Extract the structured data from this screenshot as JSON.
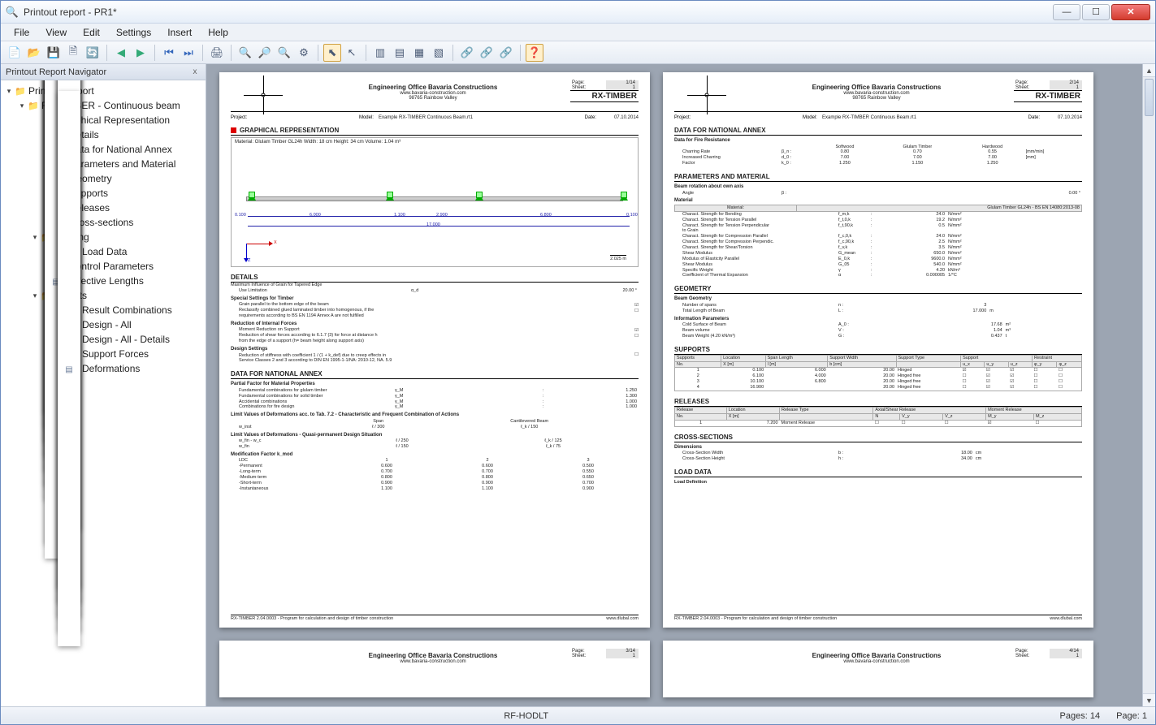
{
  "window": {
    "title": "Printout report - PR1*"
  },
  "menu": {
    "file": "File",
    "view": "View",
    "edit": "Edit",
    "settings": "Settings",
    "insert": "Insert",
    "help": "Help"
  },
  "navigator": {
    "title": "Printout Report Navigator",
    "close": "x"
  },
  "tree": {
    "root": "Printout Report",
    "n1": "RX-TIMBER - Continuous beam",
    "graphical": "Graphical Representation",
    "details": "Details",
    "annex": "Data for National Annex",
    "param": "Parameters and Material",
    "geom": "Geometry",
    "supports": "Supports",
    "releases": "Releases",
    "cross": "Cross-sections",
    "loading": "Loading",
    "loaddata": "Load Data",
    "control": "Control Parameters",
    "efflen": "Effective Lengths",
    "results": "Results",
    "rescomb": "Result Combinations",
    "designall": "Design - All",
    "designdet": "Design - All - Details",
    "suppforce": "Support Forces",
    "deform": "Deformations"
  },
  "company": {
    "name": "Engineering Office Bavaria Constructions",
    "web": "www.bavaria-construction.com",
    "addr": "98765 Rainbow Valley",
    "brand": "RX-TIMBER"
  },
  "projrow": {
    "projlbl": "Project:",
    "modellbl": "Model:",
    "model": "Example RX-TIMBER Continuous Beam.rt1",
    "datelbl": "Date:",
    "date": "07.10.2014"
  },
  "page1": {
    "pageLbl": "Page:",
    "pageVal": "1/14",
    "sheetLbl": "Sheet:",
    "sheetVal": "1",
    "s1": "GRAPHICAL REPRESENTATION",
    "beaminfo": "Material: Glulam Timber GL24h   Width: 18 cm   Height: 34 cm   Volume: 1.04 m³",
    "dim": {
      "a": "0.100",
      "b": "6.000",
      "c": "1.100",
      "d": "2.900",
      "e": "6.800",
      "f": "0.100",
      "total": "17.000"
    },
    "scale": "2.025 m",
    "details_title": "DETAILS",
    "details": {
      "l1": "Maximum Influence of Grain for Tapered Edge",
      "l1b": "Use Limitation",
      "alpha": "α_d",
      "deg20": "20.00  °",
      "l2": "Special Settings for Timber",
      "l2a": "Grain parallel to the bottom edge of the beam",
      "l2b": "Reclassify combined glued laminated timber into homogenous, if the",
      "l2c": "requirements according to BS EN 1194 Annex A are not fulfilled",
      "l3": "Reduction of Internal Forces",
      "l3a": "Moment Reduction on Support",
      "l3b": "Reduction of shear forces according to 6.1.7 (3) for force at distance h",
      "l3b2": "from the edge of a support (h= beam height along support axis)",
      "l4": "Design Settings",
      "l4a": "Reduction of stiffness with coefficient 1 / (1 + k_def) due to creep effects in",
      "l4b": "Service Classes 2 and 3 according to DIN EN 1995-1-1/NA: 2010-12, NA. 5.9"
    },
    "annex_title": "DATA FOR NATIONAL ANNEX",
    "annex": {
      "h1": "Partial Factor for Material Properties",
      "r1": "Fundamental combinations for glulam timber",
      "v1": "1.250",
      "r2": "Fundamental combinations for solid timber",
      "v2": "1.300",
      "r3": "Accidental combinations",
      "v3": "1.000",
      "r4": "Combinations for fire design",
      "v4": "1.000",
      "h2": "Limit Values of Deformations acc. to Tab. 7.2 - Characteristic and Frequent Combination of Actions",
      "span": "Span",
      "cant": "Cantilevered Beam",
      "r5": "w_inst",
      "v5a": "ℓ / 300",
      "v5b": "ℓ_k / 150",
      "h3": "Limit Values of Deformations - Quasi-permanent Design Situation",
      "r6": "w_fin - w_c",
      "v6a": "ℓ / 250",
      "v6b": "ℓ_k / 125",
      "r7": "w_fin",
      "v7a": "ℓ / 150",
      "v7b": "ℓ_k / 75",
      "h4": "Modification Factor k_mod",
      "ldc": "LDC",
      "c1": "1",
      "c2": "2",
      "c3": "3",
      "perm": "-Permanent",
      "p1": "0.600",
      "p2": "0.600",
      "p3": "0.500",
      "long": "-Long-term",
      "l1v": "0.700",
      "l2v": "0.700",
      "l3v": "0.550",
      "med": "-Medium-term",
      "m1": "0.800",
      "m2": "0.800",
      "m3": "0.650",
      "short": "-Short-term",
      "s1": "0.900",
      "s2": "0.900",
      "s3": "0.700",
      "inst": "-Instantaneous",
      "i1": "1.100",
      "i2": "1.100",
      "i3": "0.900"
    }
  },
  "page2": {
    "pageVal": "2/14",
    "sheetVal": "1",
    "annex_title": "DATA FOR NATIONAL ANNEX",
    "fire": {
      "h": "Data for Fire Resistance",
      "soft": "Softwood",
      "glu": "Glulam Timber",
      "hard": "Hardwood",
      "r1": "Charring Rate",
      "s1": "β_n :",
      "v1a": "0.80",
      "v1b": "0.70",
      "v1c": "0.55",
      "u1": "[mm/min]",
      "r2": "Increased Charring",
      "s2": "d_0 :",
      "v2a": "7.00",
      "v2b": "7.00",
      "v2c": "7.00",
      "u2": "[mm]",
      "r3": "Factor",
      "s3": "k_0 :",
      "v3a": "1.250",
      "v3b": "1.150",
      "v3c": "1.250"
    },
    "param_title": "PARAMETERS AND MATERIAL",
    "param": {
      "rot": "Beam rotation about own axis",
      "rotlbl": "Angle",
      "rotsym": "β   :",
      "rotval": "0.00  °",
      "mat": "Material",
      "matlbl": "Material:",
      "matval": "Glulam Timber GL24h - BS EN 14080:2013-08",
      "r1": "Charact. Strength for Bending",
      "s1": "f_m,k",
      "v1": "24.0",
      "u": "N/mm²",
      "r2": "Charact. Strength for Tension Parallel",
      "s2": "f_t,0,k",
      "v2": "19.2",
      "r3": "Charact. Strength for Tension Perpendicular",
      "s3": "f_t,90,k",
      "v3": "0.5",
      "r3b": "to Grain",
      "r4": "Charact. Strength for Compression Parallel",
      "s4": "f_c,0,k",
      "v4": "24.0",
      "r5": "Charact. Strength for Compression Perpendic.",
      "s5": "f_c,90,k",
      "v5": "2.5",
      "r6": "Charact. Strength for Shear/Torsion",
      "s6": "f_v,k",
      "v6": "3.5",
      "r7": "Shear Modulus",
      "s7": "G_mean",
      "v7": "650.0",
      "r8": "Modulus of Elasticity Parallel",
      "s8": "E_0,k",
      "v8": "9600.0",
      "r9": "Shear Modulus",
      "s9": "G_05",
      "v9": "540.0",
      "r10": "Specific Weight",
      "s10": "γ",
      "v10": "4.20",
      "u10": "kN/m³",
      "r11": "Coefficient of Thermal Expansion",
      "s11": "α",
      "v11": "0.000005",
      "u11": "1/°C"
    },
    "geom_title": "GEOMETRY",
    "geom": {
      "h1": "Beam Geometry",
      "r1": "Number of spans",
      "s1": "n   :",
      "v1": "3",
      "r2": "Total Length of Beam",
      "s2": "L   :",
      "v2": "17.000",
      "u2": "m",
      "h2": "Information Parameters",
      "r3": "Cold Surface of Beam",
      "s3": "A_0   :",
      "v3": "17.68",
      "u3": "m²",
      "r4": "Beam volume",
      "s4": "V   :",
      "v4": "1.04",
      "u4": "m³",
      "r5": "Beam Weight (4.20 kN/m³)",
      "s5": "G   :",
      "v5": "0.437",
      "u5": "t"
    },
    "supp_title": "SUPPORTS",
    "supp": {
      "h_no": "Supports",
      "h_loc": "Location",
      "h_span": "Span Length",
      "h_w": "Support Width",
      "h_type": "Support Type",
      "h_supp": "Support",
      "h_rest": "Restraint",
      "h_no2": "No.",
      "h_x": "X [m]",
      "h_l": "l [m]",
      "h_b": "b [cm]",
      "h_ux": "u_x",
      "h_uy": "u_y",
      "h_uz": "u_z",
      "h_fy": "φ_y",
      "h_fz": "φ_z",
      "rows": [
        {
          "n": "1",
          "x": "0.100",
          "l": "6.000",
          "b": "20.00",
          "t": "Hinged"
        },
        {
          "n": "2",
          "x": "6.100",
          "l": "4.000",
          "b": "20.00",
          "t": "Hinged free"
        },
        {
          "n": "3",
          "x": "10.100",
          "l": "6.800",
          "b": "20.00",
          "t": "Hinged free"
        },
        {
          "n": "4",
          "x": "16.900",
          "l": "",
          "b": "20.00",
          "t": "Hinged free"
        }
      ]
    },
    "rel_title": "RELEASES",
    "rel": {
      "h_no": "Release",
      "h_loc": "Location",
      "h_type": "Release Type",
      "h_ax": "Axial/Shear Release",
      "h_mom": "Moment Release",
      "h_no2": "No.",
      "h_x": "X [m]",
      "h_N": "N",
      "h_Vy": "V_y",
      "h_Vz": "V_z",
      "h_My": "M_y",
      "h_Mz": "M_z",
      "r1n": "1",
      "r1x": "7.200",
      "r1t": "Moment Release"
    },
    "cross_title": "CROSS-SECTIONS",
    "cross": {
      "h": "Dimensions",
      "r1": "Cross-Section Width",
      "s1": "b   :",
      "v1": "18.00",
      "u": "cm",
      "r2": "Cross-Section Height",
      "s2": "h   :",
      "v2": "34.00"
    },
    "load_title": "LOAD DATA",
    "load_sub": "Load Definition"
  },
  "page3": {
    "pageVal": "3/14",
    "sheetVal": "1"
  },
  "page4": {
    "pageVal": "4/14",
    "sheetVal": "1"
  },
  "footer": {
    "prog": "RX-TIMBER 2.04.0003 - Program for calculation and design of timber construction",
    "site": "www.dlubal.com"
  },
  "status": {
    "host": "RF-HODLT",
    "pagesLbl": "Pages: ",
    "pages": "14",
    "pageLbl": "Page: ",
    "page": "1"
  }
}
